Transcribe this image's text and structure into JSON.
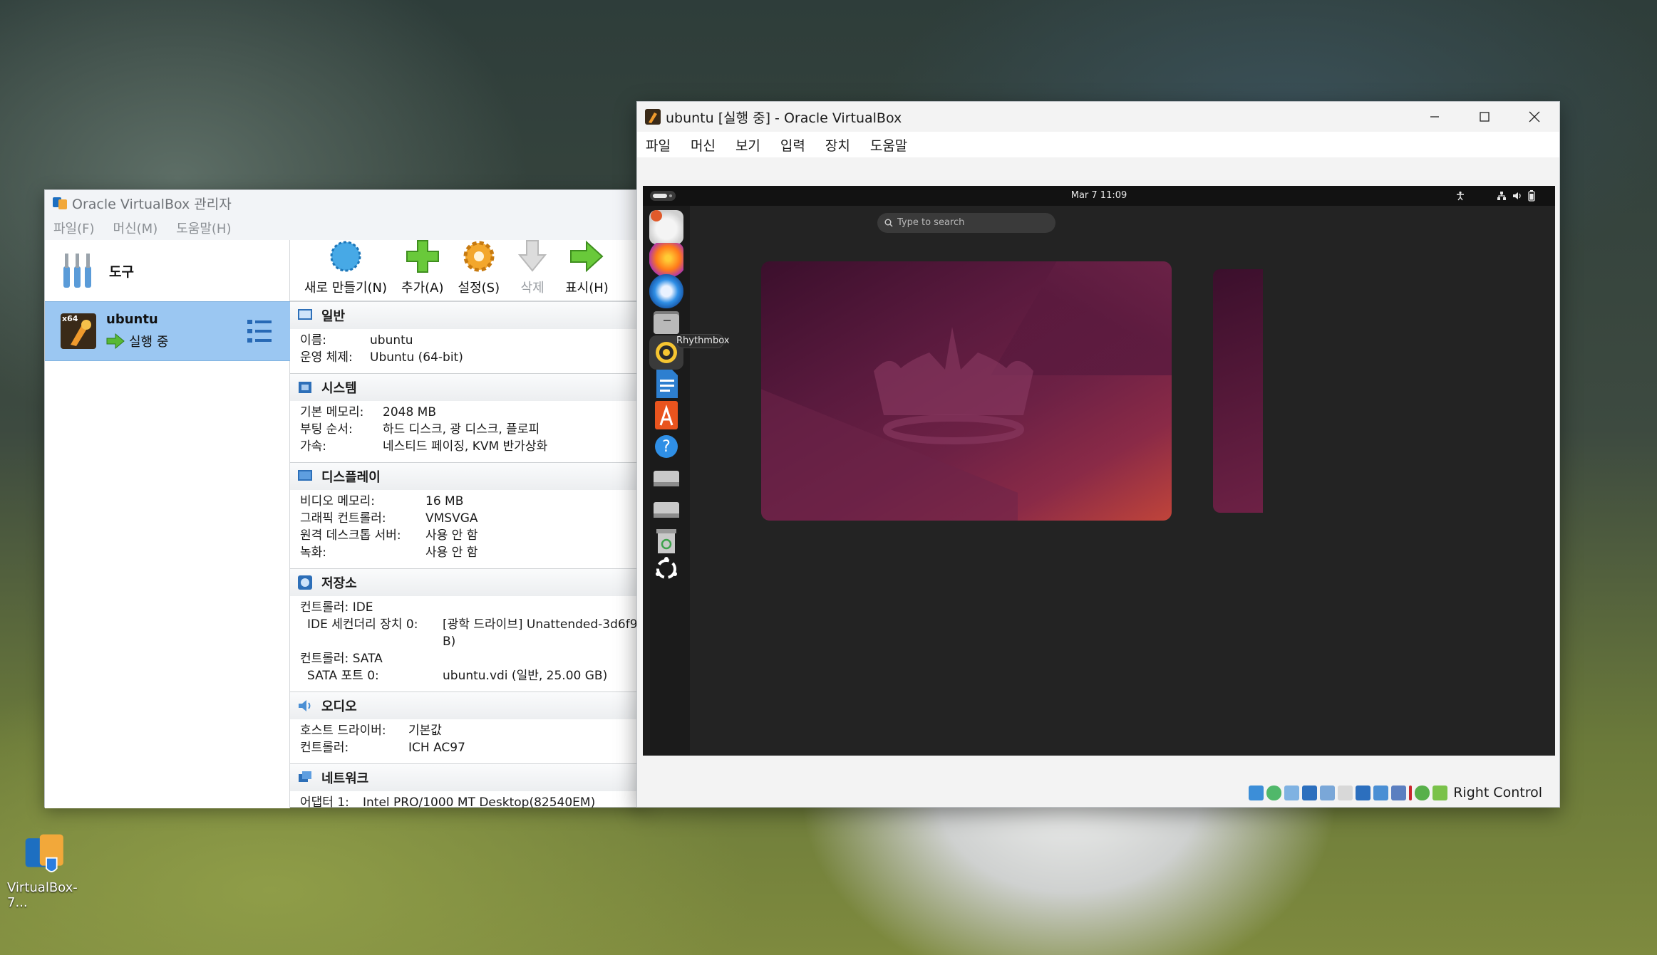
{
  "manager": {
    "title": "Oracle VirtualBox 관리자",
    "menu": [
      "파일(F)",
      "머신(M)",
      "도움말(H)"
    ],
    "tools_label": "도구",
    "vm": {
      "name": "ubuntu",
      "state": "실행 중",
      "badge": "x64"
    },
    "toolbar": {
      "new": "새로 만들기(N)",
      "add": "추가(A)",
      "settings": "설정(S)",
      "delete": "삭제",
      "show": "표시(H)"
    },
    "sections": {
      "general": {
        "title": "일반",
        "rows": [
          [
            "이름:",
            "ubuntu"
          ],
          [
            "운영 체제:",
            "Ubuntu (64-bit)"
          ]
        ]
      },
      "system": {
        "title": "시스템",
        "rows": [
          [
            "기본 메모리:",
            "2048 MB"
          ],
          [
            "부팅 순서:",
            "하드 디스크, 광 디스크, 플로피"
          ],
          [
            "가속:",
            "네스티드 페이징, KVM 반가상화"
          ]
        ]
      },
      "display": {
        "title": "디스플레이",
        "rows": [
          [
            "비디오 메모리:",
            "16 MB"
          ],
          [
            "그래픽 컨트롤러:",
            "VMSVGA"
          ],
          [
            "원격 데스크톱 서버:",
            "사용 안 함"
          ],
          [
            "녹화:",
            "사용 안 함"
          ]
        ]
      },
      "storage": {
        "title": "저장소",
        "controller1": "컨트롤러: IDE",
        "ide_label": "IDE 세컨더리 장치 0:",
        "ide_value": "[광학 드라이브] Unattended-3d6f9",
        "ide_value2": "B)",
        "controller2": "컨트롤러: SATA",
        "sata_label": "SATA 포트 0:",
        "sata_value": "ubuntu.vdi (일반, 25.00 GB)"
      },
      "audio": {
        "title": "오디오",
        "rows": [
          [
            "호스트 드라이버:",
            "기본값"
          ],
          [
            "컨트롤러:",
            "ICH AC97"
          ]
        ]
      },
      "network": {
        "title": "네트워크",
        "rows": [
          [
            "어댑터 1:",
            "Intel PRO/1000 MT Desktop(82540EM)"
          ]
        ]
      }
    }
  },
  "vm_window": {
    "title": "ubuntu [실행 중] - Oracle VirtualBox",
    "menu": [
      "파일",
      "머신",
      "보기",
      "입력",
      "장치",
      "도움말"
    ],
    "host_key": "Right Control"
  },
  "guest": {
    "clock": "Mar 7  11:09",
    "search_placeholder": "Type to search",
    "tooltip": "Rhythmbox",
    "dock": [
      "help-center-icon",
      "firefox-icon",
      "thunderbird-icon",
      "files-icon",
      "rhythmbox-icon",
      "libreoffice-writer-icon",
      "app-center-icon",
      "help-icon",
      "drive-icon",
      "drive-icon",
      "trash-icon",
      "show-apps-icon"
    ]
  },
  "desktop": {
    "icon_label": "VirtualBox-7..."
  },
  "colors": {
    "selection": "#9bc7f2",
    "wallpaper_top": "#4a1232",
    "wallpaper_bottom": "#c0443a",
    "guest_bg": "#232323"
  }
}
